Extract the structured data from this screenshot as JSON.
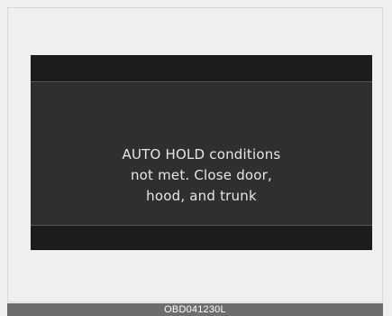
{
  "display": {
    "message_lines": [
      "AUTO HOLD conditions",
      "not met. Close door,",
      "hood, and trunk"
    ]
  },
  "caption": {
    "code": "OBD041230L"
  },
  "colors": {
    "page_background": "#efefef",
    "display_background": "#2f2f2f",
    "display_bars": "#1c1c1c",
    "message_text": "#e6e6e6",
    "caption_background": "#6d6d6d",
    "caption_text": "#ffffff"
  }
}
